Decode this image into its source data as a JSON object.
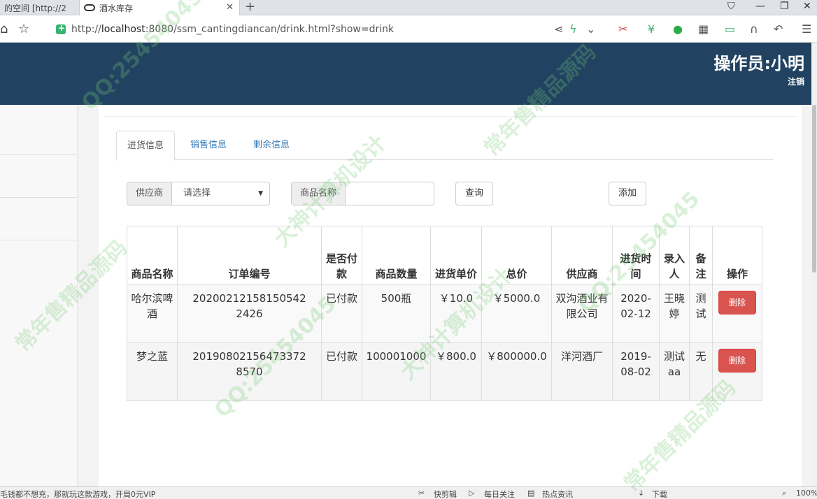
{
  "browser": {
    "tabs": [
      {
        "label": "的空间 [http://2"
      },
      {
        "label": "酒水库存"
      }
    ],
    "new_tab": "+",
    "url_prefix": "http://",
    "url_host": "localhost",
    "url_rest": ":8080/ssm_cantingdiancan/drink.html?show=drink"
  },
  "header": {
    "operator": "操作员:小明",
    "logout": "注销"
  },
  "tabs": [
    {
      "label": "进货信息",
      "active": true
    },
    {
      "label": "销售信息",
      "active": false
    },
    {
      "label": "剩余信息",
      "active": false
    }
  ],
  "filters": {
    "supplier_label": "供应商",
    "supplier_value": "请选择",
    "product_label": "商品名称",
    "product_value": "",
    "query_button": "查询",
    "add_button": "添加"
  },
  "table": {
    "headers": [
      "商品名称",
      "订单编号",
      "是否付款",
      "商品数量",
      "进货单价",
      "总价",
      "供应商",
      "进货时间",
      "录入人",
      "备注",
      "操作"
    ],
    "rows": [
      {
        "name": "哈尔滨啤酒",
        "order_no": "20200212158150542​2426",
        "paid": "已付款",
        "qty": "500瓶",
        "unit_price": "￥10.0",
        "total": "￥5000.0",
        "supplier": "双沟酒业有限公司",
        "date": "2020-02-12",
        "operator": "王晓婷",
        "note": "测试",
        "action": "删除"
      },
      {
        "name": "梦之蓝",
        "order_no": "20190802156473372​8570",
        "paid": "已付款",
        "qty": "100001000",
        "unit_price": "￥800.0",
        "total": "￥800000.0",
        "supplier": "洋河酒厂",
        "date": "2019-08-02",
        "operator": "测试aa",
        "note": "无",
        "action": "删除"
      }
    ]
  },
  "statusbar": {
    "left": "毛钱都不想充，那就玩这款游戏，开局0元VIP",
    "items": [
      "快剪辑",
      "每日关注",
      "热点资讯",
      "下载",
      "100%"
    ]
  },
  "watermarks": [
    "QQ:25454045",
    "常年售精品源码",
    "大神计算机设计",
    "QQ:25454045",
    "常年售精品源码",
    "大神计算机设计",
    "QQ:25454045",
    "常年售精品源码"
  ]
}
